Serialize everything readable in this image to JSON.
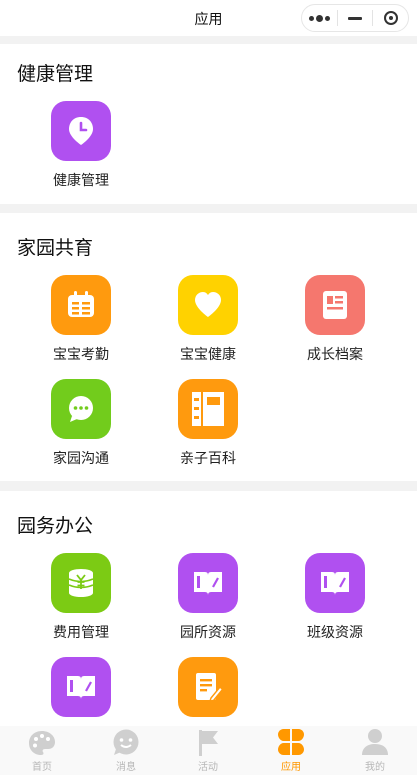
{
  "header": {
    "title": "应用"
  },
  "sections": [
    {
      "title": "健康管理",
      "items": [
        {
          "label": "健康管理",
          "icon": "clock-pin-icon",
          "color": "#b050f0"
        }
      ]
    },
    {
      "title": "家园共育",
      "items": [
        {
          "label": "宝宝考勤",
          "icon": "calendar-icon",
          "color": "#ff9a0e"
        },
        {
          "label": "宝宝健康",
          "icon": "heart-icon",
          "color": "#ffd200"
        },
        {
          "label": "成长档案",
          "icon": "document-icon",
          "color": "#f5776e"
        },
        {
          "label": "家园沟通",
          "icon": "chat-bubble-icon",
          "color": "#72cc1c"
        },
        {
          "label": "亲子百科",
          "icon": "notebook-icon",
          "color": "#ff9a0e"
        }
      ]
    },
    {
      "title": "园务办公",
      "items": [
        {
          "label": "费用管理",
          "icon": "coin-stack-icon",
          "color": "#7ccb14"
        },
        {
          "label": "园所资源",
          "icon": "open-book-icon",
          "color": "#b050f0"
        },
        {
          "label": "班级资源",
          "icon": "open-book-icon",
          "color": "#b050f0"
        },
        {
          "label": "",
          "icon": "open-book-icon",
          "color": "#b050f0"
        },
        {
          "label": "",
          "icon": "edit-document-icon",
          "color": "#ff9a0e"
        }
      ]
    }
  ],
  "tabbar": [
    {
      "label": "首页",
      "icon": "palette-icon",
      "active": false
    },
    {
      "label": "消息",
      "icon": "chat-face-icon",
      "active": false
    },
    {
      "label": "活动",
      "icon": "flag-icon",
      "active": false
    },
    {
      "label": "应用",
      "icon": "clover-icon",
      "active": true
    },
    {
      "label": "我的",
      "icon": "user-icon",
      "active": false
    }
  ],
  "colors": {
    "active_tab": "#ff9800",
    "inactive_tab": "#c8c8c8",
    "background": "#f2f2f2"
  }
}
